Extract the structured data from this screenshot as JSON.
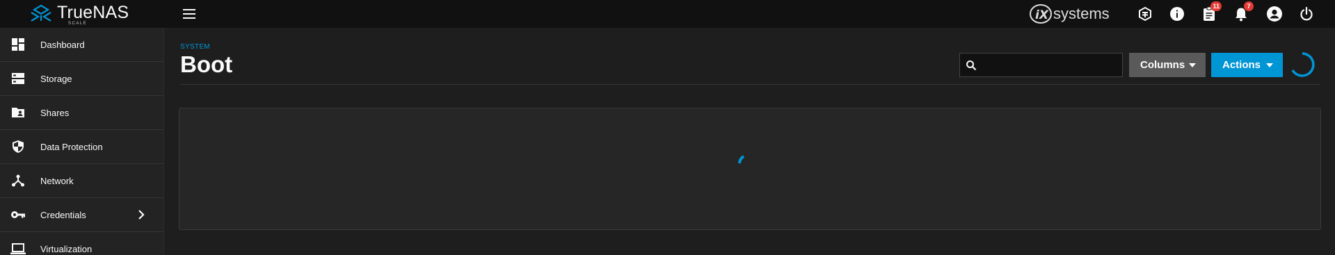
{
  "app": {
    "brand_name": "TrueNAS",
    "brand_edition": "SCALE",
    "vendor_logo_text": "systems",
    "accent_color": "#0095d5"
  },
  "topbar": {
    "icons": [
      {
        "name": "truecommand-icon"
      },
      {
        "name": "help-info-icon"
      },
      {
        "name": "jobs-clipboard-icon",
        "badge": "11"
      },
      {
        "name": "alerts-bell-icon",
        "badge": "7"
      },
      {
        "name": "account-circle-icon"
      },
      {
        "name": "power-icon"
      }
    ]
  },
  "sidebar": {
    "items": [
      {
        "label": "Dashboard",
        "icon": "dashboard-icon"
      },
      {
        "label": "Storage",
        "icon": "storage-icon"
      },
      {
        "label": "Shares",
        "icon": "folder-shared-icon"
      },
      {
        "label": "Data Protection",
        "icon": "shield-icon"
      },
      {
        "label": "Network",
        "icon": "network-icon"
      },
      {
        "label": "Credentials",
        "icon": "key-icon",
        "has_submenu": true
      },
      {
        "label": "Virtualization",
        "icon": "laptop-icon"
      }
    ]
  },
  "page": {
    "breadcrumb": "SYSTEM",
    "title": "Boot",
    "search": {
      "value": "",
      "placeholder": ""
    },
    "columns_label": "Columns",
    "actions_label": "Actions",
    "loading": true
  }
}
